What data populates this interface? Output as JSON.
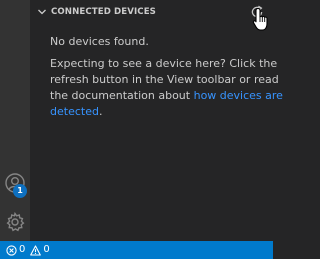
{
  "sidebar": {
    "header": {
      "title": "CONNECTED DEVICES",
      "collapse_icon": "chevron-down-icon",
      "refresh_icon": "refresh-icon"
    },
    "empty_message": "No devices found.",
    "help": {
      "line1": "Expecting to see a device here? Click the",
      "line2": "refresh button in the View toolbar or read",
      "line3_prefix": "the documentation about ",
      "link_part1": "how devices are",
      "link_part2": "detected",
      "suffix": "."
    }
  },
  "activitybar": {
    "accounts_icon": "account-icon",
    "accounts_badge": "1",
    "manage_icon": "gear-icon"
  },
  "statusbar": {
    "errors": "0",
    "warnings": "0"
  },
  "colors": {
    "link": "#3794ff",
    "statusbar": "#007acc",
    "badge": "#0e70c0"
  }
}
